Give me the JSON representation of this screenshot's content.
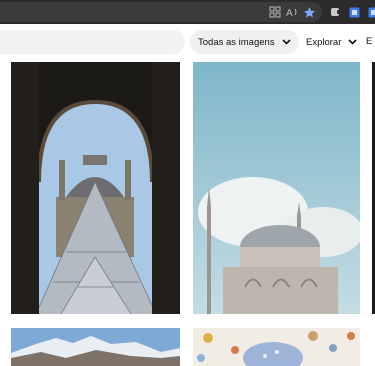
{
  "browser": {
    "toolbar_icons": [
      "grid-view-icon",
      "read-aloud-icon",
      "favorite-star-icon",
      "extension-icon",
      "extension-square-icon",
      "extension-square-icon"
    ]
  },
  "toolbar": {
    "all_images_label": "Todas as imagens",
    "explore_label": "Explorar",
    "cut_off_label": "E"
  },
  "colors": {
    "chrome_bg": "#2b2b2b",
    "accent_blue": "#3f7cf2",
    "pill_bg": "#f0f0f0"
  },
  "grid": {
    "photos": [
      {
        "subject": "Louvre pyramid framed by archway"
      },
      {
        "subject": "Mosque with minarets under blue sky"
      },
      {
        "subject": "Dark image edge"
      },
      {
        "subject": "Snowy mountain range"
      },
      {
        "subject": "Floral pattern illustration"
      }
    ]
  }
}
